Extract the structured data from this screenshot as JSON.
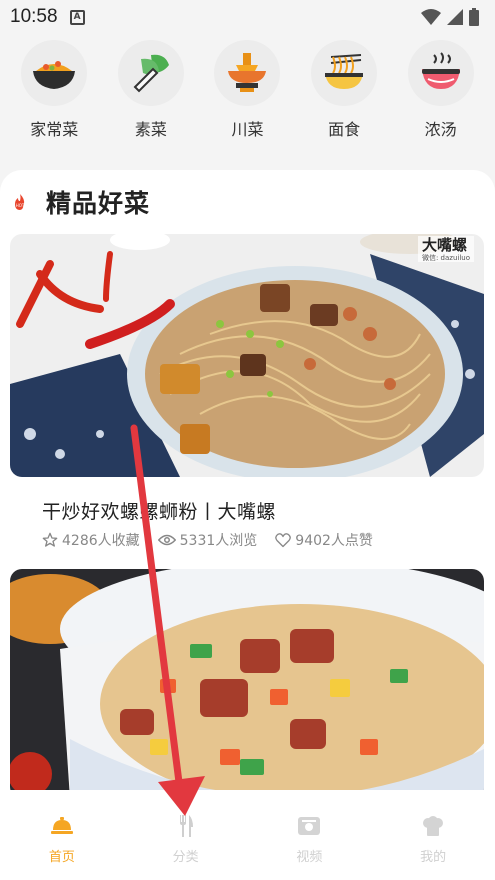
{
  "status_bar": {
    "time": "10:58",
    "notif_letter": "A"
  },
  "categories": [
    {
      "label": "家常菜",
      "icon": "home-dish-icon"
    },
    {
      "label": "素菜",
      "icon": "vegetable-icon"
    },
    {
      "label": "川菜",
      "icon": "hotpot-icon"
    },
    {
      "label": "面食",
      "icon": "noodle-icon"
    },
    {
      "label": "浓汤",
      "icon": "soup-icon"
    }
  ],
  "section": {
    "title": "精品好菜",
    "hot_icon": "hot-icon"
  },
  "recipes": [
    {
      "title": "干炒好欢螺螺蛳粉丨大嘴螺",
      "favorites": "4286人收藏",
      "views": "5331人浏览",
      "likes": "9402人点赞",
      "watermark": "大嘴螺",
      "watermark_sub": "微信: dazuiluo"
    },
    {
      "title": ""
    }
  ],
  "bottom_nav": [
    {
      "label": "首页",
      "icon": "home-icon",
      "active": true
    },
    {
      "label": "分类",
      "icon": "fork-knife-icon",
      "active": false
    },
    {
      "label": "视频",
      "icon": "video-icon",
      "active": false
    },
    {
      "label": "我的",
      "icon": "chef-hat-icon",
      "active": false
    }
  ],
  "colors": {
    "accent": "#f5a623",
    "hot": "#e8452d",
    "arrow": "#e2383f"
  }
}
